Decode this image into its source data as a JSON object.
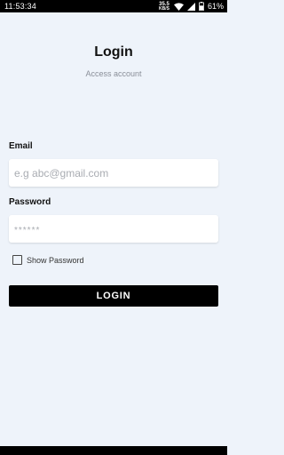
{
  "status_bar": {
    "time": "11:53:34",
    "net_speed_value": "35.5",
    "net_speed_unit": "KB/S",
    "battery_percent": "61%",
    "icons": [
      "wifi-icon",
      "signal-icon",
      "battery-icon"
    ]
  },
  "login": {
    "title": "Login",
    "subtitle": "Access account",
    "email_label": "Email",
    "email_placeholder": "e.g abc@gmail.com",
    "password_label": "Password",
    "password_placeholder": "******",
    "show_password_label": "Show Password",
    "show_password_checked": false,
    "button_label": "LOGIN"
  },
  "colors": {
    "background": "#eef3fa",
    "button": "#000000",
    "button_text": "#ffffff"
  }
}
